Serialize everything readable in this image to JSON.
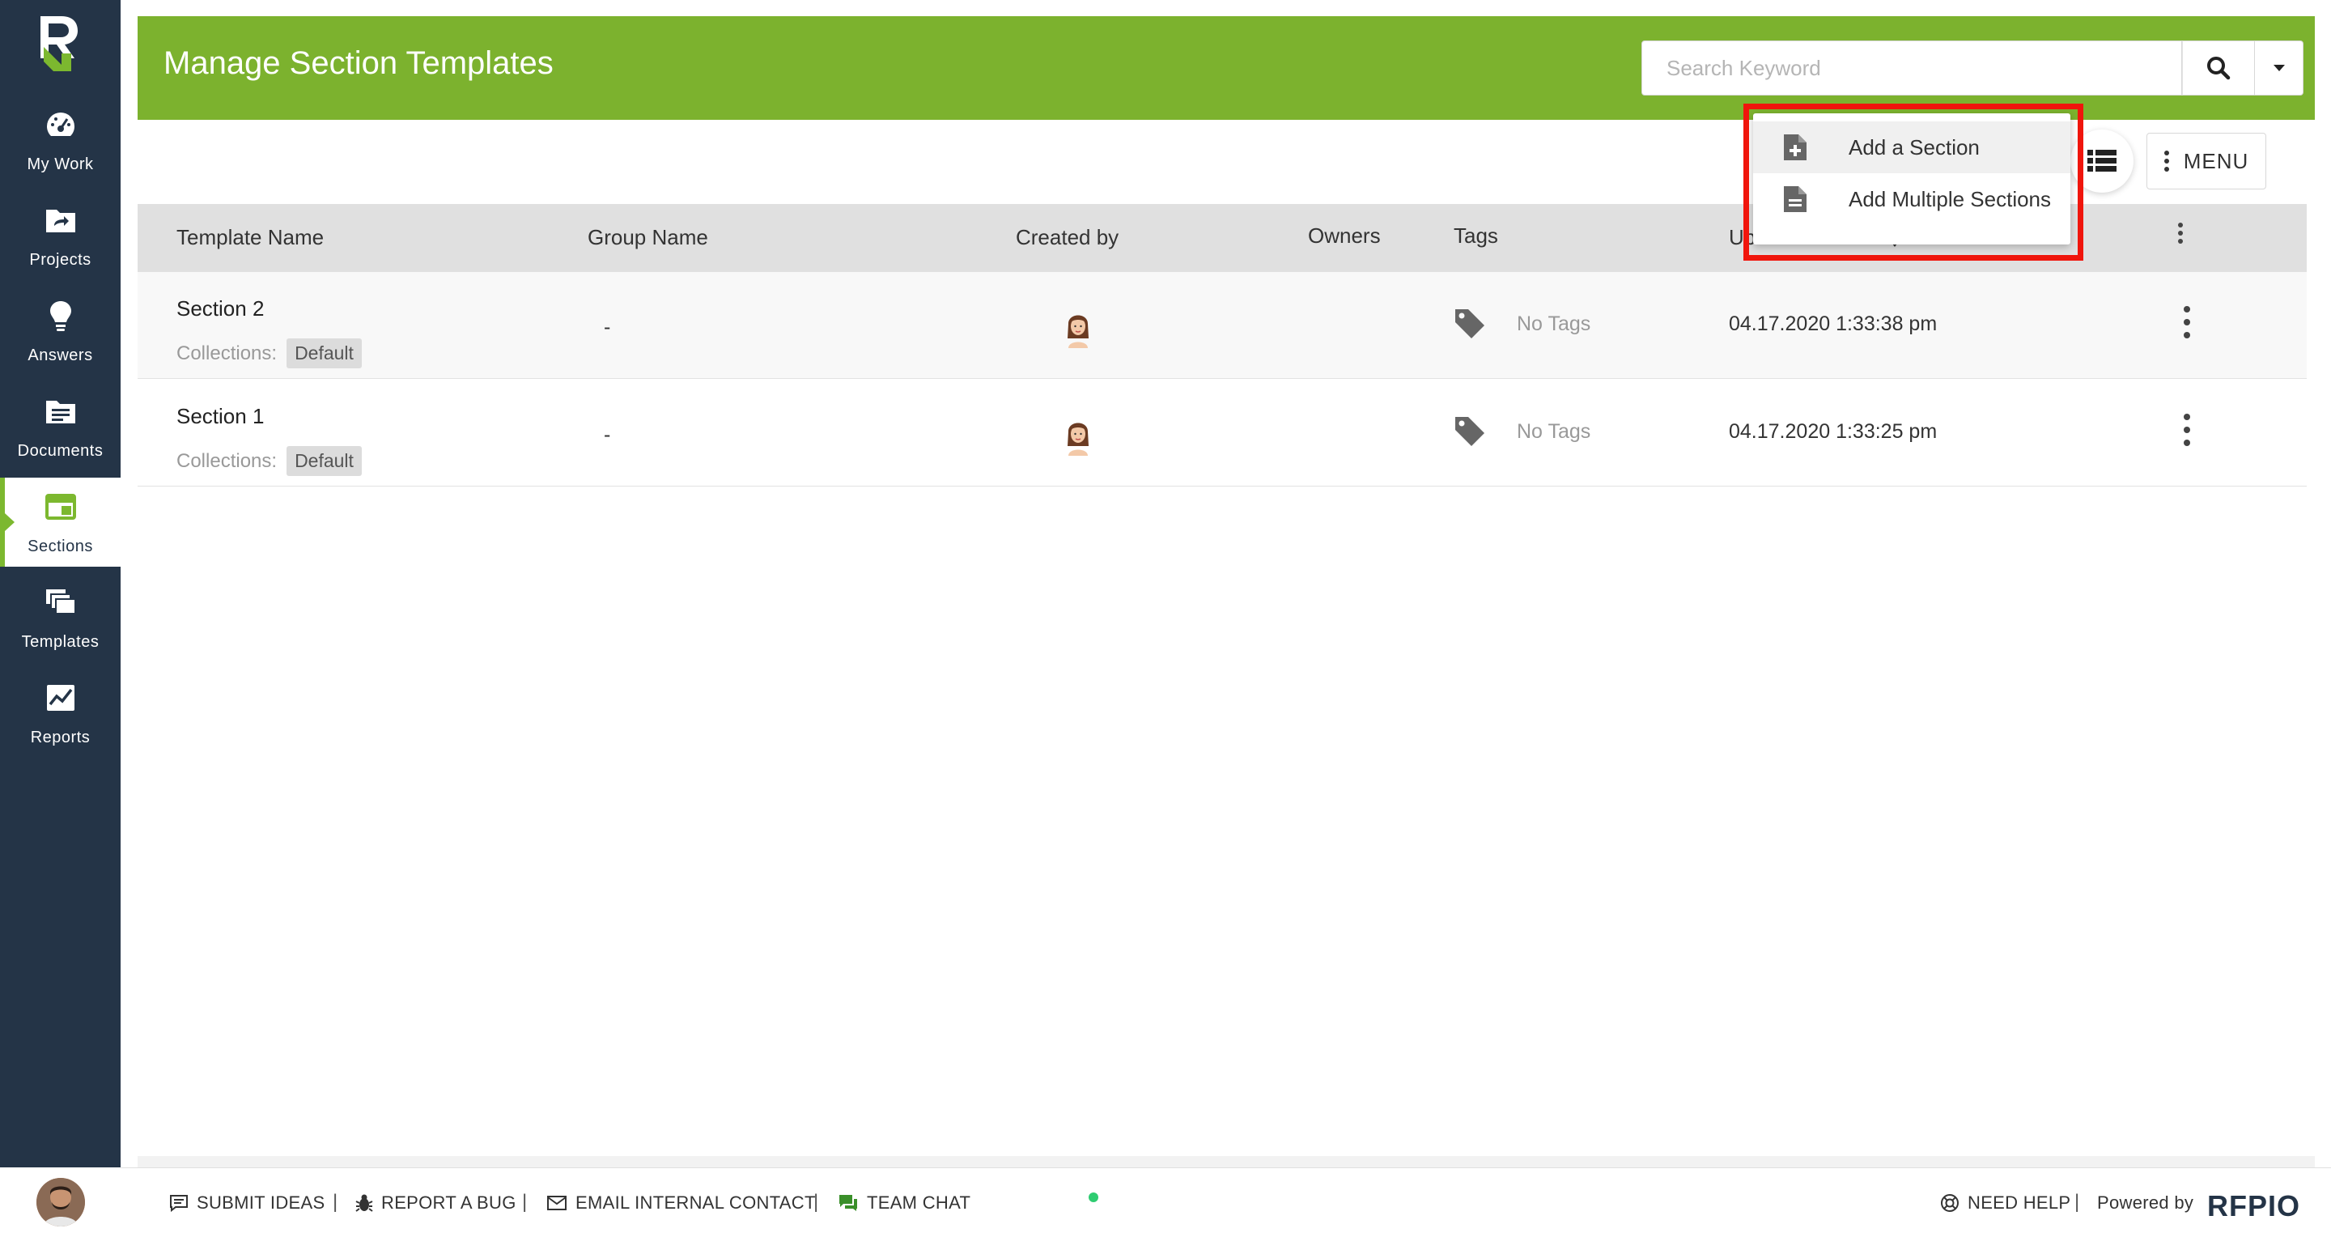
{
  "sidebar": {
    "items": [
      {
        "label": "My Work",
        "icon": "speedometer-icon"
      },
      {
        "label": "Projects",
        "icon": "folder-share-icon"
      },
      {
        "label": "Answers",
        "icon": "lightbulb-icon"
      },
      {
        "label": "Documents",
        "icon": "document-folder-icon"
      },
      {
        "label": "Sections",
        "icon": "sections-icon"
      },
      {
        "label": "Templates",
        "icon": "templates-icon"
      },
      {
        "label": "Reports",
        "icon": "chart-icon"
      }
    ],
    "active": "Sections"
  },
  "header": {
    "title": "Manage Section Templates",
    "search_placeholder": "Search Keyword"
  },
  "toolbar": {
    "menu_label": "MENU"
  },
  "dropdown": {
    "items": [
      {
        "label": "Add a Section",
        "icon": "file-add-icon"
      },
      {
        "label": "Add Multiple Sections",
        "icon": "file-text-icon"
      }
    ]
  },
  "table": {
    "columns": [
      "Template Name",
      "Group Name",
      "Created by",
      "Owners",
      "Tags",
      "Up"
    ],
    "rows": [
      {
        "name": "Section 2",
        "collections_label": "Collections:",
        "collection": "Default",
        "group": "-",
        "tags": "No Tags",
        "updated": "04.17.2020 1:33:38 pm"
      },
      {
        "name": "Section 1",
        "collections_label": "Collections:",
        "collection": "Default",
        "group": "-",
        "tags": "No Tags",
        "updated": "04.17.2020 1:33:25 pm"
      }
    ]
  },
  "footer": {
    "submit_ideas": "SUBMIT IDEAS",
    "report_bug": "REPORT A BUG",
    "email_contact": "EMAIL INTERNAL CONTACT",
    "team_chat": "TEAM CHAT",
    "need_help": "NEED HELP",
    "powered_by": "Powered by",
    "brand": "RFPIO",
    "separator": "|"
  },
  "colors": {
    "header_green": "#7cb22e",
    "sidebar_navy": "#243447",
    "highlight_red": "#f0150c"
  }
}
